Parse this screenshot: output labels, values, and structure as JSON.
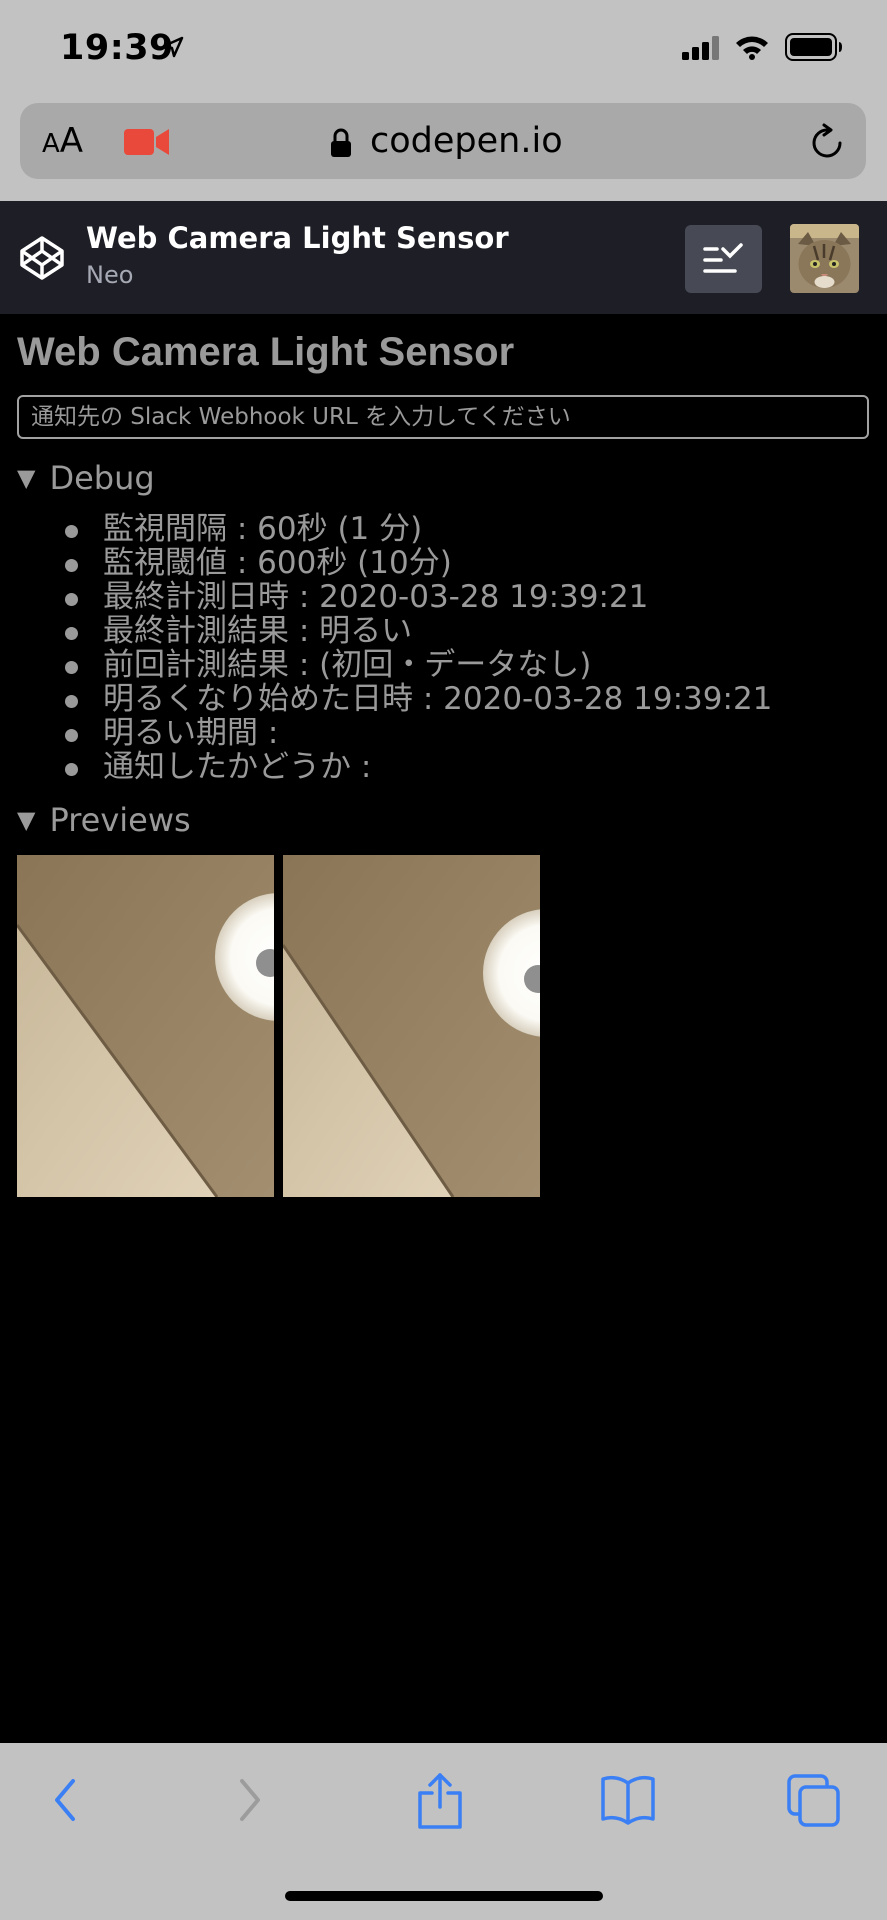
{
  "status_bar": {
    "time": "19:39",
    "icons": [
      "location-arrow-icon",
      "cellular-signal-icon",
      "wifi-icon",
      "battery-icon"
    ]
  },
  "browser": {
    "text_size_small": "A",
    "text_size_large": "A",
    "url": "codepen.io",
    "icons": [
      "camera-recording-icon",
      "lock-icon",
      "reload-icon"
    ],
    "accent_color": "#e9493a"
  },
  "codepen_header": {
    "pen_title": "Web Camera Light Sensor",
    "author": "Neo",
    "icons": [
      "codepen-logo-icon",
      "view-menu-icon",
      "user-avatar"
    ]
  },
  "page": {
    "heading": "Web Camera Light Sensor",
    "webhook_input": {
      "placeholder": "通知先の Slack Webhook URL を入力してください",
      "value": ""
    },
    "debug": {
      "summary": "Debug",
      "items": [
        "監視間隔 : 60秒 (1 分)",
        "監視閾値 : 600秒 (10分)",
        "最終計測日時 : 2020-03-28 19:39:21",
        "最終計測結果 : 明るい",
        "前回計測結果 : (初回・データなし)",
        "明るくなり始めた日時 : 2020-03-28 19:39:21",
        "明るい期間 :",
        "通知したかどうか :"
      ]
    },
    "previews": {
      "summary": "Previews",
      "count": 2
    }
  },
  "toolbar": {
    "icons": [
      "back-icon",
      "forward-icon",
      "share-icon",
      "bookmarks-icon",
      "tabs-icon"
    ],
    "accent_color": "#3b7ff5"
  }
}
